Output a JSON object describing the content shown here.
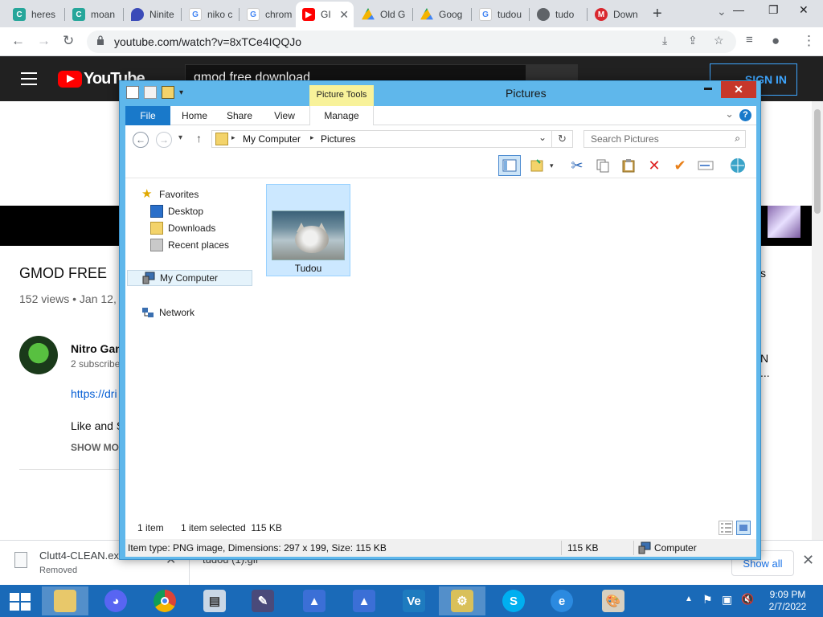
{
  "browser": {
    "tabs": [
      {
        "title": "heres",
        "icon": "classroom-icon",
        "active": false
      },
      {
        "title": "moan",
        "icon": "classroom-icon",
        "active": false
      },
      {
        "title": "Ninite",
        "icon": "ninite-icon",
        "active": false
      },
      {
        "title": "niko c",
        "icon": "google-icon",
        "active": false
      },
      {
        "title": "chrom",
        "icon": "google-icon",
        "active": false
      },
      {
        "title": "GI",
        "icon": "youtube-icon",
        "active": true
      },
      {
        "title": "Old G",
        "icon": "google-drive-icon",
        "active": false
      },
      {
        "title": "Goog",
        "icon": "google-drive-icon",
        "active": false
      },
      {
        "title": "tudou",
        "icon": "google-icon",
        "active": false
      },
      {
        "title": "tudo",
        "icon": "globe-icon",
        "active": false
      },
      {
        "title": "Down",
        "icon": "mega-icon",
        "active": false
      }
    ],
    "url": "youtube.com/watch?v=8xTCe4IQQJo",
    "window_controls": {
      "minimize": "—",
      "restore": "❐",
      "close": "✕"
    },
    "new_tab": "+",
    "tab_search": "⌄"
  },
  "youtube": {
    "logo_text": "YouTube",
    "search_value": "gmod free download",
    "sign_in": "SIGN IN",
    "video_title": "GMOD FREE",
    "video_meta": "152 views • Jan 12,",
    "channel_name": "Nitro Gam",
    "subscribers": "2 subscribe",
    "link_text": "https://dri",
    "desc_line": "Like and S",
    "show_more": "SHOW MOR",
    "right_fragments": [
      "s",
      "N",
      "..."
    ]
  },
  "downloads": {
    "items": [
      {
        "name": "Clutt4-CLEAN.exe",
        "status": "Removed"
      },
      {
        "name": "tudou (1).gif",
        "status": ""
      }
    ],
    "show_all": "Show all",
    "close": "✕"
  },
  "explorer": {
    "title": "Pictures",
    "contextual_tab": "Picture Tools",
    "ribbon_tabs": [
      "File",
      "Home",
      "Share",
      "View",
      "Manage"
    ],
    "breadcrumb": [
      "My Computer",
      "Pictures"
    ],
    "search_placeholder": "Search Pictures",
    "nav": {
      "favorites": "Favorites",
      "favorites_items": [
        "Desktop",
        "Downloads",
        "Recent places"
      ],
      "computer": "My Computer",
      "network": "Network"
    },
    "files": [
      {
        "name": "Tudou",
        "type": "PNG image",
        "selected": true
      }
    ],
    "status": {
      "item_count": "1 item",
      "selection": "1 item selected  115 KB"
    },
    "details": {
      "info": "Item type: PNG image, Dimensions: 297 x 199, Size: 115 KB",
      "size": "115 KB",
      "location": "Computer"
    },
    "close_glyph": "✕",
    "minimize_glyph": "▬"
  },
  "taskbar": {
    "pinned": [
      {
        "name": "file-explorer",
        "icon": "folder-icon",
        "color": "#e8c86a",
        "glyph": ""
      },
      {
        "name": "discord",
        "icon": "discord-icon",
        "color": "#5865f2",
        "glyph": "◕"
      },
      {
        "name": "chrome",
        "icon": "chrome-icon",
        "color": "#ffffff",
        "glyph": ""
      },
      {
        "name": "control-panel",
        "icon": "monitor-icon",
        "color": "#c9d7e6",
        "glyph": "▤"
      },
      {
        "name": "paint-tool",
        "icon": "paint-icon",
        "color": "#4a4a7a",
        "glyph": "✎"
      },
      {
        "name": "sail-app-1",
        "icon": "sail-icon",
        "color": "#3b6fd6",
        "glyph": "▲"
      },
      {
        "name": "sail-app-2",
        "icon": "sail-icon",
        "color": "#3b6fd6",
        "glyph": "▲"
      },
      {
        "name": "vb-app",
        "icon": "vb-icon",
        "color": "#1e7bbf",
        "glyph": "Ve"
      },
      {
        "name": "gears-app",
        "icon": "gears-icon",
        "color": "#d9c05a",
        "glyph": "⚙"
      },
      {
        "name": "skype",
        "icon": "skype-icon",
        "color": "#00aff0",
        "glyph": "S"
      },
      {
        "name": "internet-explorer",
        "icon": "ie-icon",
        "color": "#2b8ae0",
        "glyph": "e"
      },
      {
        "name": "paint",
        "icon": "palette-icon",
        "color": "#d8d0c0",
        "glyph": "🎨"
      }
    ],
    "tray_glyphs": [
      "▲",
      "⚑",
      "▣",
      "🔇"
    ],
    "time": "9:09 PM",
    "date": "2/7/2022"
  }
}
